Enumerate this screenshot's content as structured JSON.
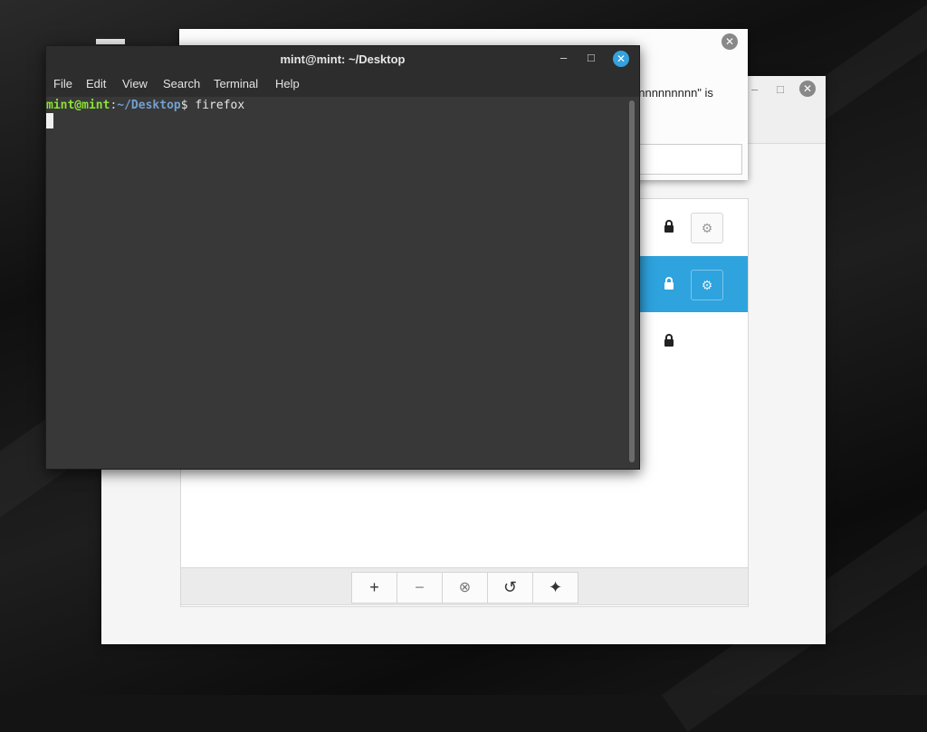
{
  "terminal": {
    "title": "mint@mint: ~/Desktop",
    "menu": [
      "File",
      "Edit",
      "View",
      "Search",
      "Terminal",
      "Help"
    ],
    "prompt_user": "mint@mint",
    "prompt_sep": ":",
    "prompt_path": "~/Desktop",
    "prompt_dollar": "$ ",
    "command": "firefox",
    "controls": {
      "minimize": "–",
      "maximize": "□",
      "close": "✕"
    }
  },
  "dialog": {
    "message_fragment": "nnnnnnnnnn\" is",
    "close": "✕"
  },
  "back_window": {
    "controls": {
      "minimize": "–",
      "maximize": "□",
      "close": "✕"
    },
    "rows": [
      {
        "selected": false,
        "locked": true,
        "has_settings": true
      },
      {
        "selected": true,
        "locked": true,
        "has_settings": true
      },
      {
        "selected": false,
        "locked": true,
        "has_settings": false
      }
    ],
    "toolbar": {
      "add": "+",
      "remove": "−",
      "clear": "⊗",
      "undo": "↺",
      "star": "✦"
    }
  },
  "colors": {
    "selection": "#2ea3dd",
    "terminal_close": "#35a1dd",
    "prompt_user": "#8ae234",
    "prompt_path": "#729fcf"
  }
}
